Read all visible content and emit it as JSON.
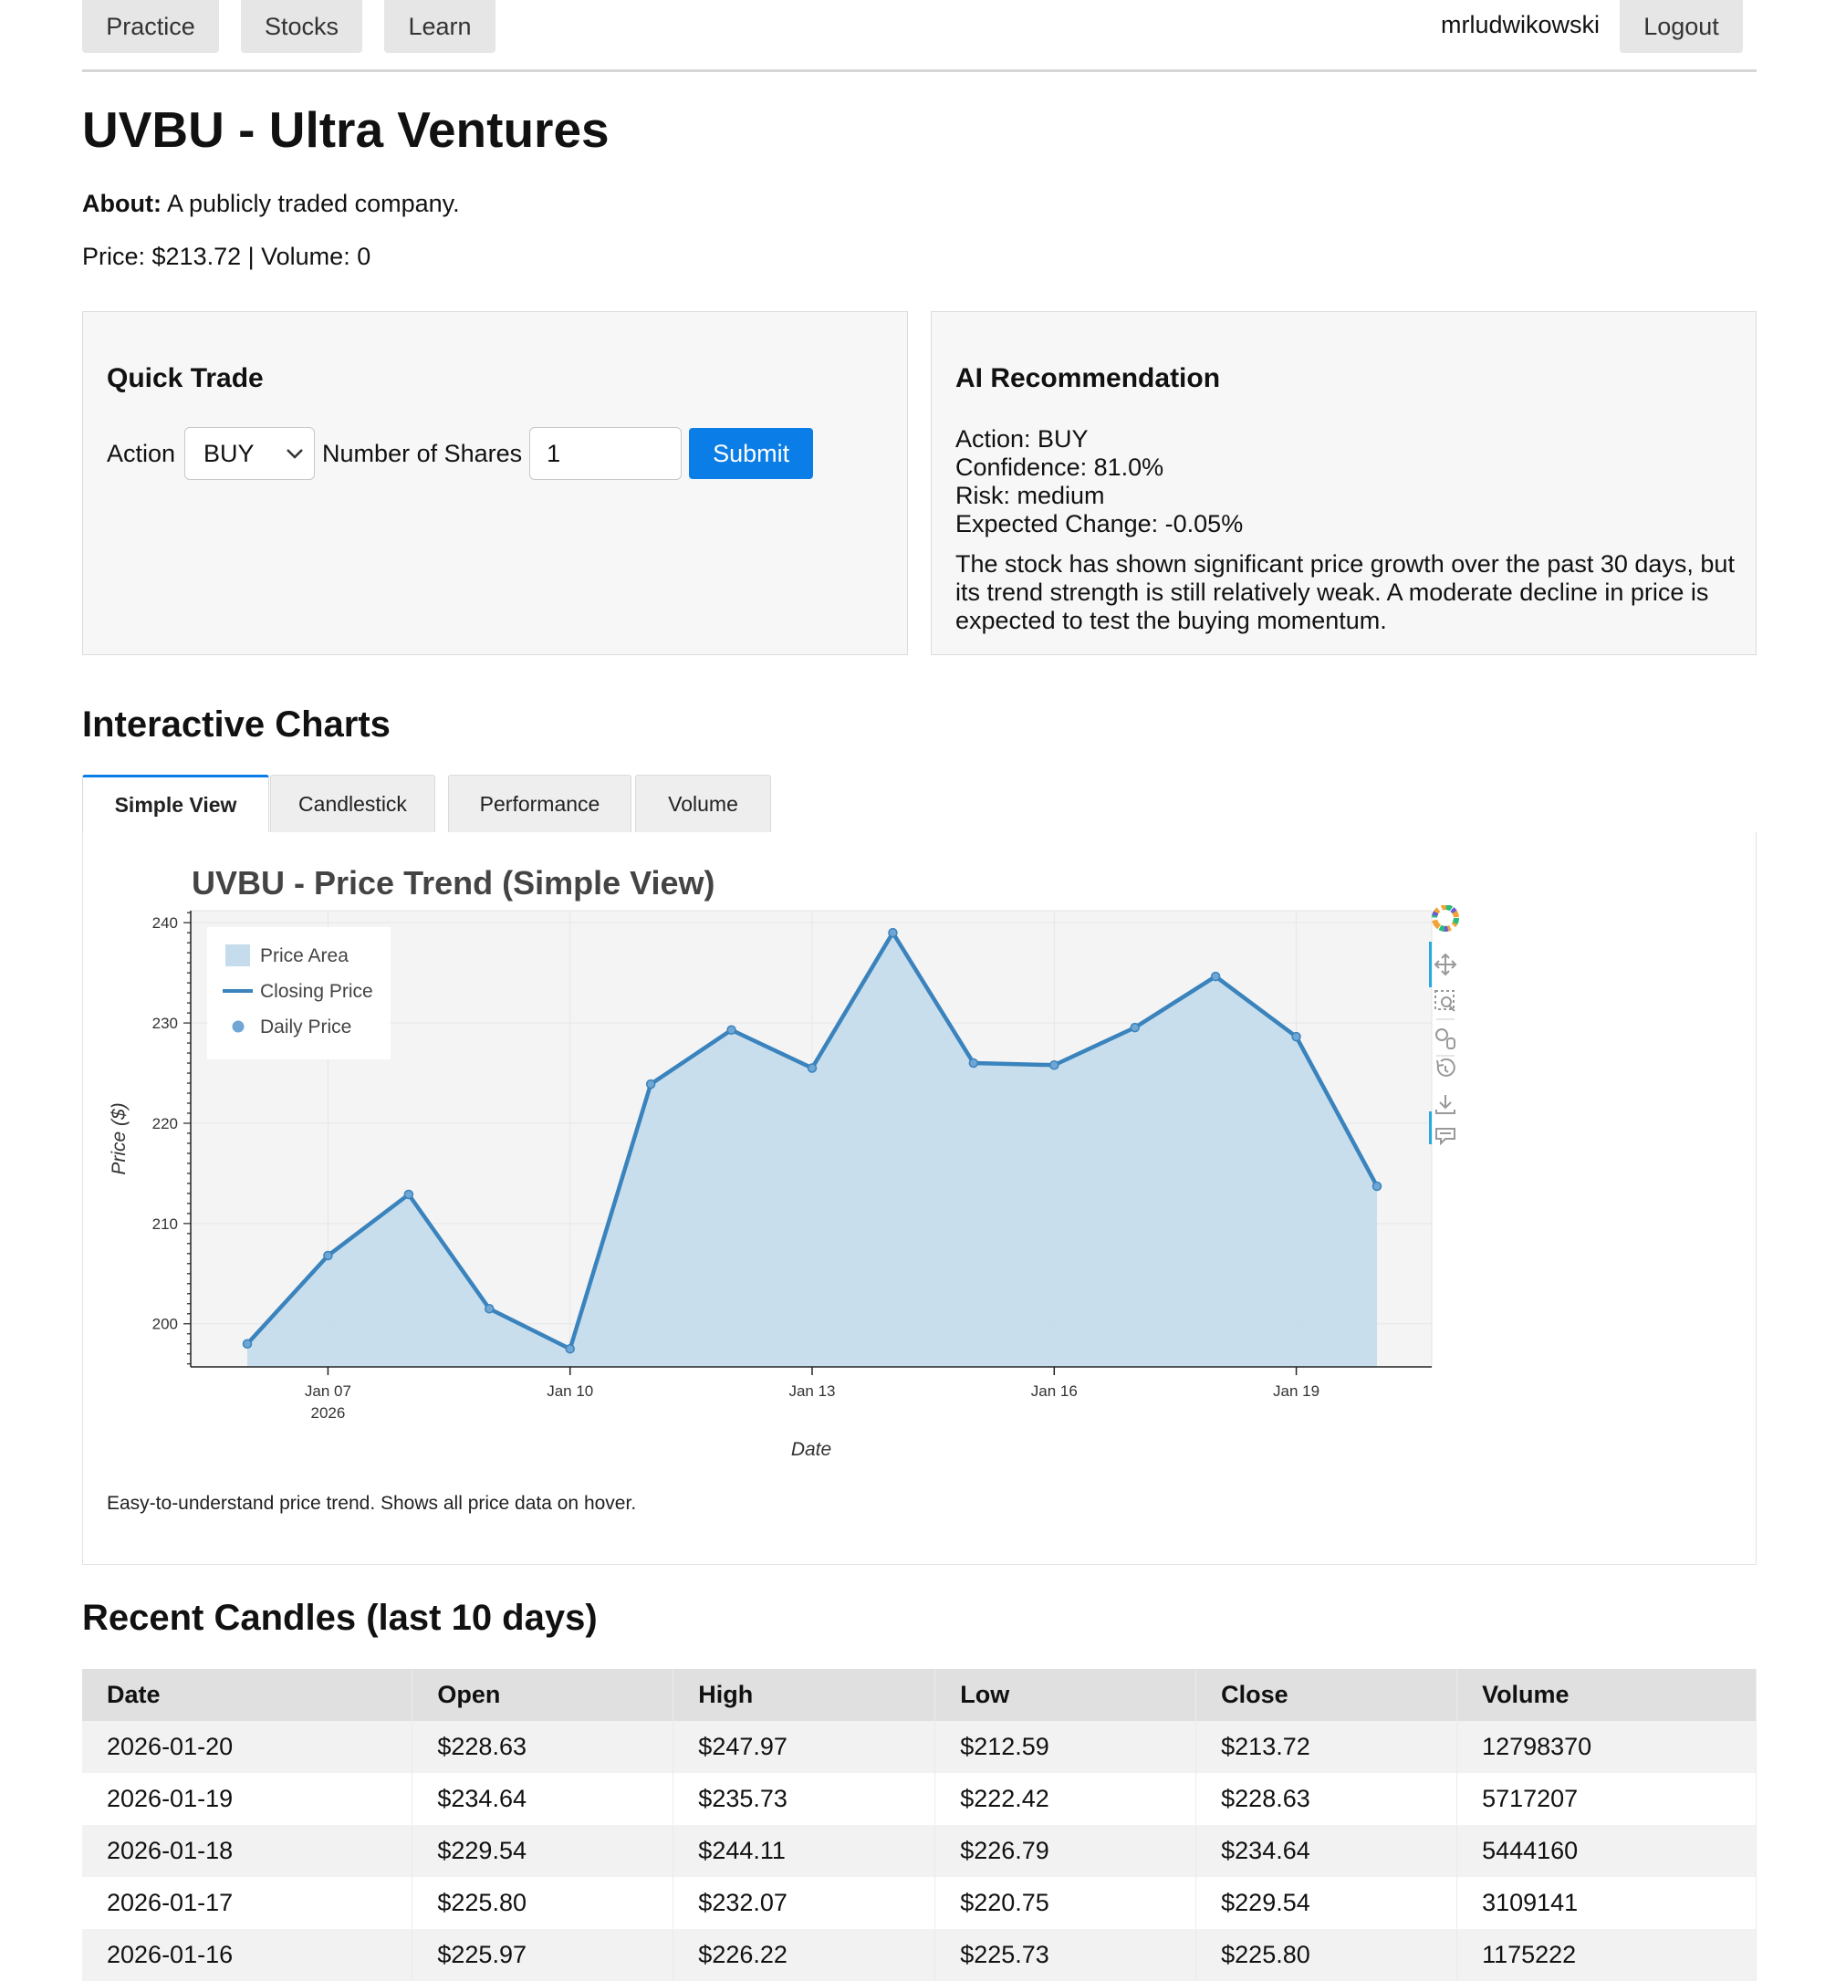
{
  "nav": {
    "items": [
      "Practice",
      "Stocks",
      "Learn"
    ],
    "username": "mrludwikowski",
    "logout_label": "Logout"
  },
  "stock": {
    "title": "UVBU - Ultra Ventures",
    "about_label": "About:",
    "about_text": "A publicly traded company.",
    "price_line": "Price: $213.72 | Volume: 0"
  },
  "quick_trade": {
    "heading": "Quick Trade",
    "action_label": "Action",
    "action_value": "BUY",
    "shares_label": "Number of Shares",
    "shares_value": "1",
    "submit_label": "Submit"
  },
  "ai": {
    "heading": "AI Recommendation",
    "action": "Action: BUY",
    "confidence": "Confidence: 81.0%",
    "risk": "Risk: medium",
    "expected_change": "Expected Change: -0.05%",
    "explanation": "The stock has shown significant price growth over the past 30 days, but its trend strength is still relatively weak. A moderate decline in price is expected to test the buying momentum."
  },
  "charts": {
    "heading": "Interactive Charts",
    "tabs": [
      "Simple View",
      "Candlestick",
      "Performance",
      "Volume"
    ],
    "active_tab": "Simple View",
    "caption": "Easy-to-understand price trend. Shows all price data on hover."
  },
  "chart_data": {
    "type": "line",
    "title": "UVBU - Price Trend (Simple View)",
    "xlabel": "Date",
    "ylabel": "Price ($)",
    "x": [
      "2026-01-06",
      "2026-01-07",
      "2026-01-08",
      "2026-01-09",
      "2026-01-10",
      "2026-01-11",
      "2026-01-12",
      "2026-01-13",
      "2026-01-14",
      "2026-01-15",
      "2026-01-16",
      "2026-01-17",
      "2026-01-18",
      "2026-01-19",
      "2026-01-20"
    ],
    "x_tick_labels": [
      {
        "date": "2026-01-07",
        "label": "Jan 07",
        "sublabel": "2026"
      },
      {
        "date": "2026-01-10",
        "label": "Jan 10",
        "sublabel": ""
      },
      {
        "date": "2026-01-13",
        "label": "Jan 13",
        "sublabel": ""
      },
      {
        "date": "2026-01-16",
        "label": "Jan 16",
        "sublabel": ""
      },
      {
        "date": "2026-01-19",
        "label": "Jan 19",
        "sublabel": ""
      }
    ],
    "y_ticks": [
      200,
      210,
      220,
      230,
      240
    ],
    "ylim": [
      195.7,
      241.2
    ],
    "grid": true,
    "legend_position": "top-left",
    "series": [
      {
        "name": "Price Area",
        "kind": "area",
        "color": "#c5dcec"
      },
      {
        "name": "Closing Price",
        "kind": "line",
        "color": "#3a83bd"
      },
      {
        "name": "Daily Price",
        "kind": "points",
        "color": "#6fa6d4"
      }
    ],
    "values": [
      198.0,
      206.8,
      212.9,
      201.5,
      197.5,
      223.9,
      229.3,
      225.5,
      239.0,
      226.0,
      225.8,
      229.54,
      234.64,
      228.63,
      213.72
    ]
  },
  "candles": {
    "heading": "Recent Candles (last 10 days)",
    "columns": [
      "Date",
      "Open",
      "High",
      "Low",
      "Close",
      "Volume"
    ],
    "rows": [
      [
        "2026-01-20",
        "$228.63",
        "$247.97",
        "$212.59",
        "$213.72",
        "12798370"
      ],
      [
        "2026-01-19",
        "$234.64",
        "$235.73",
        "$222.42",
        "$228.63",
        "5717207"
      ],
      [
        "2026-01-18",
        "$229.54",
        "$244.11",
        "$226.79",
        "$234.64",
        "5444160"
      ],
      [
        "2026-01-17",
        "$225.80",
        "$232.07",
        "$220.75",
        "$229.54",
        "3109141"
      ],
      [
        "2026-01-16",
        "$225.97",
        "$226.22",
        "$225.73",
        "$225.80",
        "1175222"
      ]
    ]
  },
  "colors": {
    "accent": "#0a7de6",
    "line": "#3a83bd",
    "area": "#c5dcec"
  }
}
